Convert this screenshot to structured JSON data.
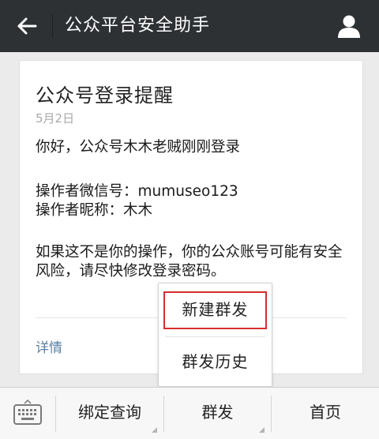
{
  "header": {
    "title": "公众平台安全助手",
    "back_icon": "back-arrow-icon",
    "profile_icon": "user-profile-icon",
    "background": "#2e3134"
  },
  "message": {
    "title": "公众号登录提醒",
    "date": "5月2日",
    "greeting": "你好，公众号木木老贼刚刚登录",
    "operator_wechat": "操作者微信号：mumuseo123",
    "operator_nickname": "操作者昵称：木木",
    "warning_line1": "如果这不是你的操作，你的公众账号可能有安全",
    "warning_line2": "风险，请尽快修改登录密码。",
    "detail_link": "详情"
  },
  "popup_menu": {
    "items": [
      {
        "label": "新建群发",
        "highlighted": true
      },
      {
        "label": "群发历史",
        "highlighted": false
      }
    ],
    "highlight_color": "#d62d2d"
  },
  "bottom_bar": {
    "keyboard_icon": "keyboard-icon",
    "items": [
      {
        "label": "绑定查询",
        "has_submenu": true
      },
      {
        "label": "群发",
        "has_submenu": true
      },
      {
        "label": "首页",
        "has_submenu": false
      }
    ]
  }
}
